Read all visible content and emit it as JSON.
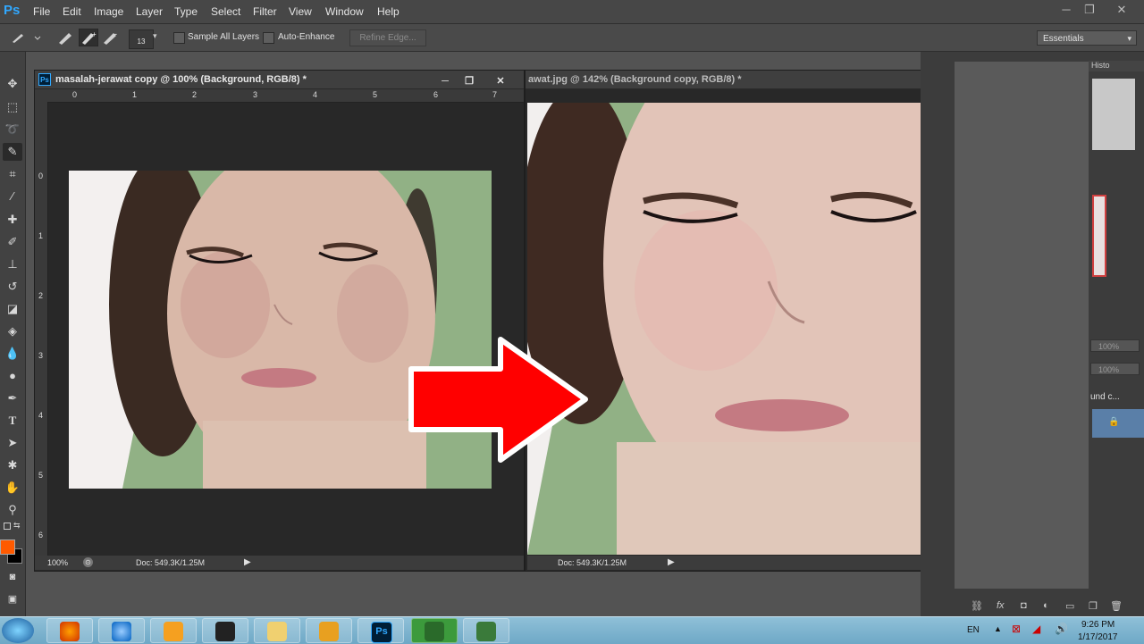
{
  "app": {
    "logo": "Ps"
  },
  "menu": [
    "File",
    "Edit",
    "Image",
    "Layer",
    "Type",
    "Select",
    "Filter",
    "View",
    "Window",
    "Help"
  ],
  "window_controls": {
    "minimize": "─",
    "restore": "❐",
    "close": "✕"
  },
  "options_bar": {
    "brush_size": "13",
    "sample_all_layers": "Sample All Layers",
    "auto_enhance": "Auto-Enhance",
    "refine_edge": "Refine Edge...",
    "workspace": "Essentials"
  },
  "doc1": {
    "title": "masalah-jerawat copy @ 100% (Background, RGB/8) *",
    "ruler_h": [
      "0",
      "1",
      "2",
      "3",
      "4",
      "5",
      "6",
      "7"
    ],
    "ruler_v": [
      "0",
      "1",
      "2",
      "3",
      "4",
      "5",
      "6"
    ],
    "zoom": "100%",
    "doc_size": "Doc: 549.3K/1.25M"
  },
  "doc2": {
    "title": "awat.jpg @ 142% (Background copy, RGB/8) *",
    "doc_size": "Doc: 549.3K/1.25M"
  },
  "panels": {
    "histo_tab": "Histo",
    "opacity": "100%",
    "fill": "100%",
    "layer_label": "und c..."
  },
  "colors": {
    "foreground": "#ff5a00",
    "background": "#000000",
    "arrow": "#ff0000",
    "green_bg": "#91b185"
  },
  "taskbar": {
    "lang": "EN",
    "time": "9:26 PM",
    "date": "1/17/2017"
  }
}
